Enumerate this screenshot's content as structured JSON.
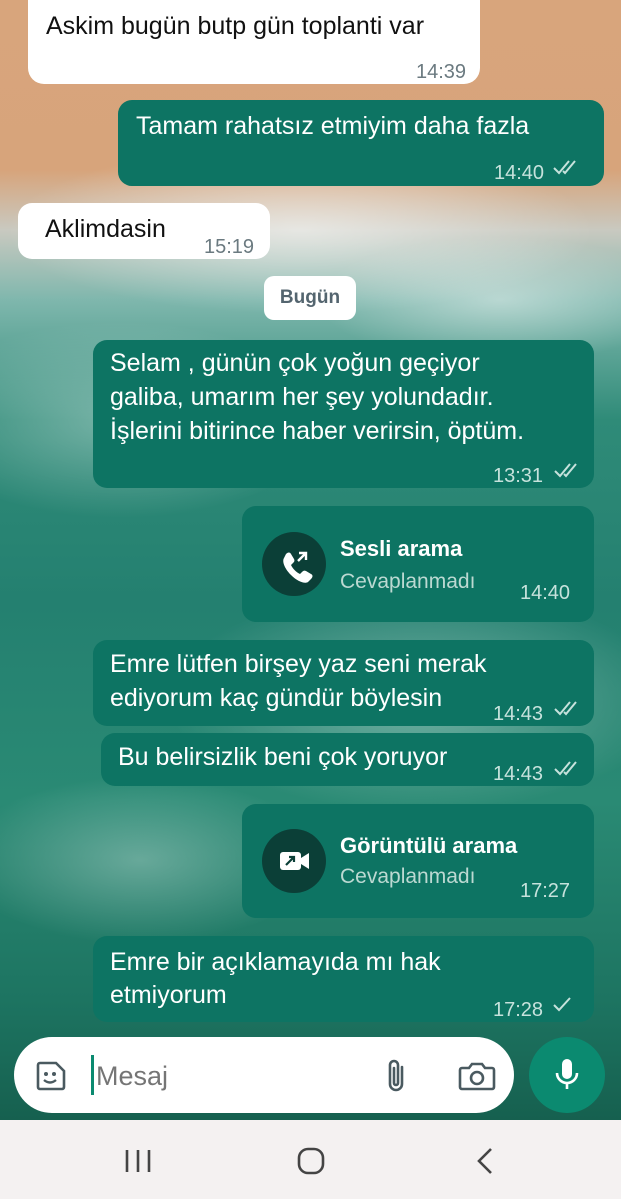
{
  "messages": [
    {
      "text": "Askim bugün butp gün toplanti var",
      "time": "14:39"
    },
    {
      "text": "Tamam rahatsız etmiyim daha fazla",
      "time": "14:40",
      "status": "read"
    },
    {
      "text": "Aklimdasin",
      "time": "15:19"
    },
    {
      "line1": "Selam , günün çok yoğun geçiyor",
      "line2": "galiba, umarım her şey yolundadır.",
      "line3": "İşlerini bitirince haber verirsin, öptüm.",
      "time": "13:31",
      "status": "read"
    },
    {
      "title": "Sesli arama",
      "subtitle": "Cevaplanmadı",
      "time": "14:40",
      "icon": "missed-voice-call-icon"
    },
    {
      "line1": "Emre lütfen birşey yaz seni merak",
      "line2": "ediyorum kaç gündür böylesin",
      "time": "14:43",
      "status": "read"
    },
    {
      "text": "Bu belirsizlik beni çok yoruyor",
      "time": "14:43",
      "status": "read"
    },
    {
      "title": "Görüntülü arama",
      "subtitle": "Cevaplanmadı",
      "time": "17:27",
      "icon": "missed-video-call-icon"
    },
    {
      "line1": "Emre bir açıklamayıda mı hak",
      "line2": "etmiyorum",
      "time": "17:28",
      "status": "sent"
    }
  ],
  "date_divider": "Bugün",
  "composer": {
    "placeholder": "Mesaj"
  },
  "colors": {
    "incoming_bubble": "#ffffff",
    "outgoing_bubble": "#0d7463",
    "accent": "#0b8a70"
  }
}
